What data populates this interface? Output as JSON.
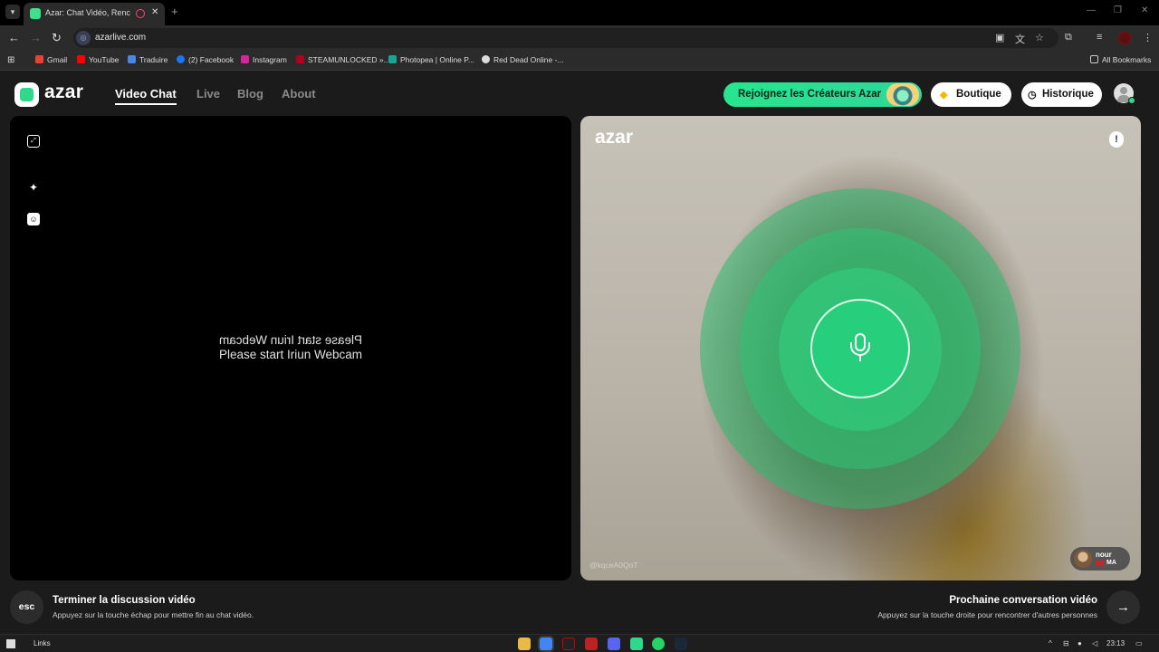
{
  "browser": {
    "tab_title": "Azar: Chat Vidéo, Rencontre",
    "url": "azarlive.com",
    "bookmarks": [
      "Gmail",
      "YouTube",
      "Traduire",
      "(2) Facebook",
      "Instagram",
      "STEAMUNLOCKED »...",
      "Photopea | Online P...",
      "Red Dead Online -..."
    ],
    "all_bookmarks": "All Bookmarks"
  },
  "colors": {
    "accent": "#2fd88b",
    "background": "#1b1b1b",
    "local_video_bg": "#000000"
  },
  "header": {
    "logo": "azar",
    "nav": [
      "Video Chat",
      "Live",
      "Blog",
      "About"
    ],
    "active_nav": "Video Chat",
    "creators_button": "Rejoignez les Créateurs Azar",
    "shop_button": "Boutique",
    "history_button": "Historique"
  },
  "local_video": {
    "message_mirrored": "Please start Iriun Webcam",
    "message": "Please start Iriun Webcam"
  },
  "remote_video": {
    "logo": "azar",
    "user_id": "@kqceA0QoT",
    "peer_name": "nour",
    "peer_country": "MA"
  },
  "actions": {
    "end_key": "esc",
    "end_title": "Terminer la discussion vidéo",
    "end_subtitle": "Appuyez sur la touche échap pour mettre fin au chat vidéo.",
    "next_title": "Prochaine conversation vidéo",
    "next_subtitle": "Appuyez sur la touche droite pour rencontrer d'autres personnes",
    "next_arrow": "→"
  },
  "taskbar": {
    "links": "Links",
    "time": "23:13"
  }
}
